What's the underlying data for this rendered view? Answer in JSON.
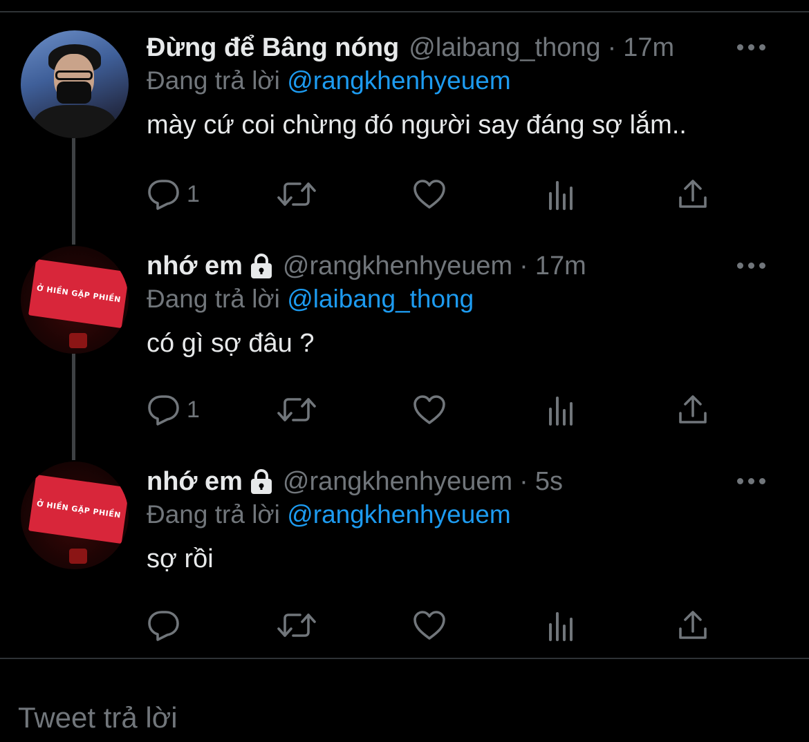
{
  "tweets": [
    {
      "display_name": "Đừng để Bâng nóng",
      "handle": "@laibang_thong",
      "separator": "·",
      "time": "17m",
      "protected": false,
      "replying_prefix": "Đang trả lời",
      "replying_to": "@rangkhenhyeuem",
      "text": "mày cứ coi chừng đó người say đáng sợ lắm..",
      "reply_count": "1"
    },
    {
      "display_name": "nhớ em",
      "handle": "@rangkhenhyeuem",
      "separator": "·",
      "time": "17m",
      "protected": true,
      "replying_prefix": "Đang trả lời",
      "replying_to": "@laibang_thong",
      "text": "có gì sợ đâu ?",
      "reply_count": "1",
      "avatar_text": "Ở HIỀN GẶP PHIỀN"
    },
    {
      "display_name": "nhớ em",
      "handle": "@rangkhenhyeuem",
      "separator": "·",
      "time": "5s",
      "protected": true,
      "replying_prefix": "Đang trả lời",
      "replying_to": "@rangkhenhyeuem",
      "text": "sợ rồi",
      "reply_count": "",
      "avatar_text": "Ở HIỀN GẶP PHIỀN"
    }
  ],
  "reply_box": {
    "placeholder": "Tweet trả lời"
  },
  "colors": {
    "background": "#000000",
    "text": "#e7e9ea",
    "secondary_text": "#71767b",
    "link": "#1d9bf0",
    "divider": "#2f3336"
  }
}
